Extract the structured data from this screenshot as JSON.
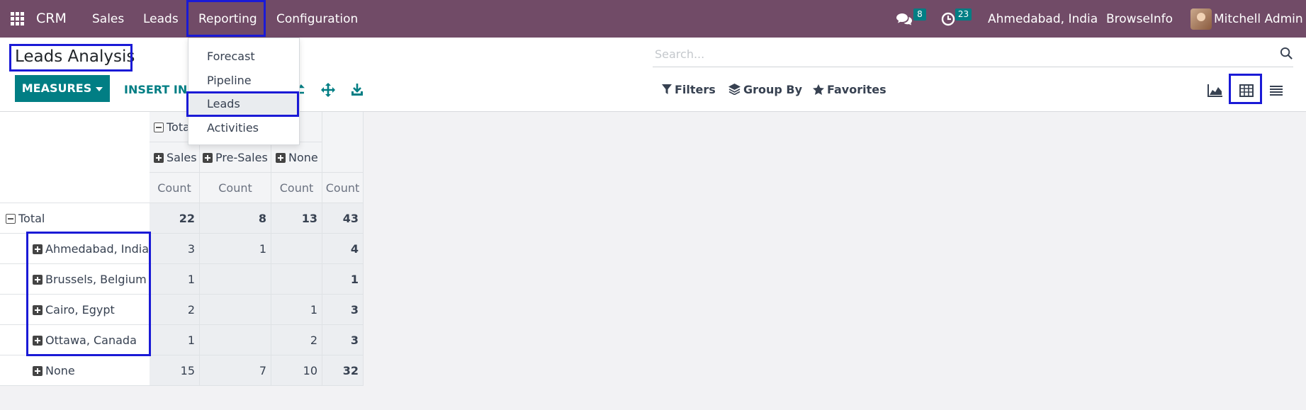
{
  "navbar": {
    "app_name": "CRM",
    "menu": [
      "Sales",
      "Leads",
      "Reporting",
      "Configuration"
    ],
    "messages_count": "8",
    "activities_count": "23",
    "company_location": "Ahmedabad, India",
    "company_name": "BrowseInfo",
    "user_name": "Mitchell Admin"
  },
  "reporting_menu": {
    "items": [
      "Forecast",
      "Pipeline",
      "Leads",
      "Activities"
    ],
    "active_item": "Leads"
  },
  "control_panel": {
    "title": "Leads Analysis",
    "search_placeholder": "Search...",
    "measures_label": "MEASURES",
    "insert_label": "INSERT IN SPREADSHEET",
    "filters_label": "Filters",
    "group_by_label": "Group By",
    "favorites_label": "Favorites",
    "views": [
      "graph-view",
      "pivot-view",
      "list-view"
    ],
    "active_view": "pivot-view"
  },
  "pivot": {
    "col_total_label": "Total",
    "col_groups": [
      "Sales",
      "Pre-Sales",
      "None"
    ],
    "measure_label": "Count",
    "row_total_label": "Total",
    "rows": [
      {
        "label": "Total",
        "values": [
          "22",
          "8",
          "13",
          "43"
        ]
      },
      {
        "label": "Ahmedabad, India",
        "values": [
          "3",
          "1",
          "",
          "4"
        ]
      },
      {
        "label": "Brussels, Belgium",
        "values": [
          "1",
          "",
          "",
          "1"
        ]
      },
      {
        "label": "Cairo, Egypt",
        "values": [
          "2",
          "",
          "1",
          "3"
        ]
      },
      {
        "label": "Ottawa, Canada",
        "values": [
          "1",
          "",
          "2",
          "3"
        ]
      },
      {
        "label": "None",
        "values": [
          "15",
          "7",
          "10",
          "32"
        ]
      }
    ]
  },
  "colors": {
    "navbar": "#714b67",
    "primary": "#017e84",
    "highlight": "#1a1ad6"
  }
}
